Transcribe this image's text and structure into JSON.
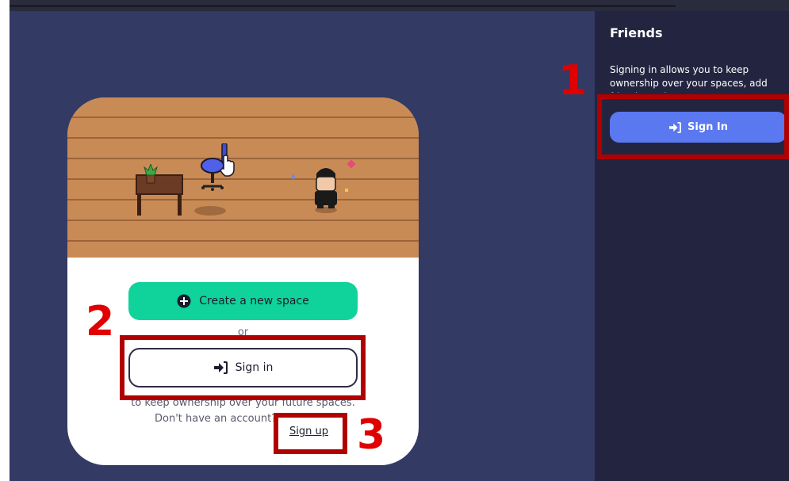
{
  "sidebar": {
    "title": "Friends",
    "description": "Signing in allows you to keep ownership over your spaces, add friends, and more!",
    "signin_label": "Sign In"
  },
  "card": {
    "create_label": "Create a new space",
    "or_text": "or",
    "signin_label": "Sign in",
    "prompt_line": "to keep ownership over your future spaces.",
    "account_prompt": "Don't have an account?",
    "signup_label": "Sign up"
  },
  "annotations": [
    "1",
    "2",
    "3"
  ],
  "colors": {
    "main_bg": "#333a64",
    "sidebar_bg": "#232540",
    "accent_blue": "#5a78f0",
    "create_green": "#0fd39b",
    "annotation_red": "#b00000"
  },
  "icons": {
    "signin": "sign-in-icon",
    "plus": "plus-circle-icon"
  }
}
